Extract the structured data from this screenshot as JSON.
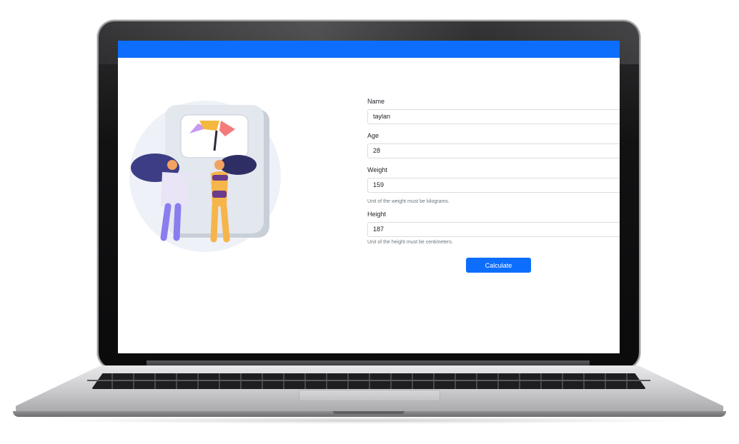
{
  "form": {
    "name_label": "Name",
    "name_value": "taylan",
    "age_label": "Age",
    "age_value": "28",
    "weight_label": "Weight",
    "weight_value": "159",
    "weight_help": "Unit of the weight must be kilograms.",
    "height_label": "Height",
    "height_value": "187",
    "height_help": "Unit of the height must be centimeters.",
    "submit_label": "Calculate"
  },
  "colors": {
    "primary": "#0d6efd",
    "input_border": "#d8dde2",
    "help_text": "#6c757d"
  },
  "illustration": {
    "icon": "weighing-scale-illustration"
  }
}
